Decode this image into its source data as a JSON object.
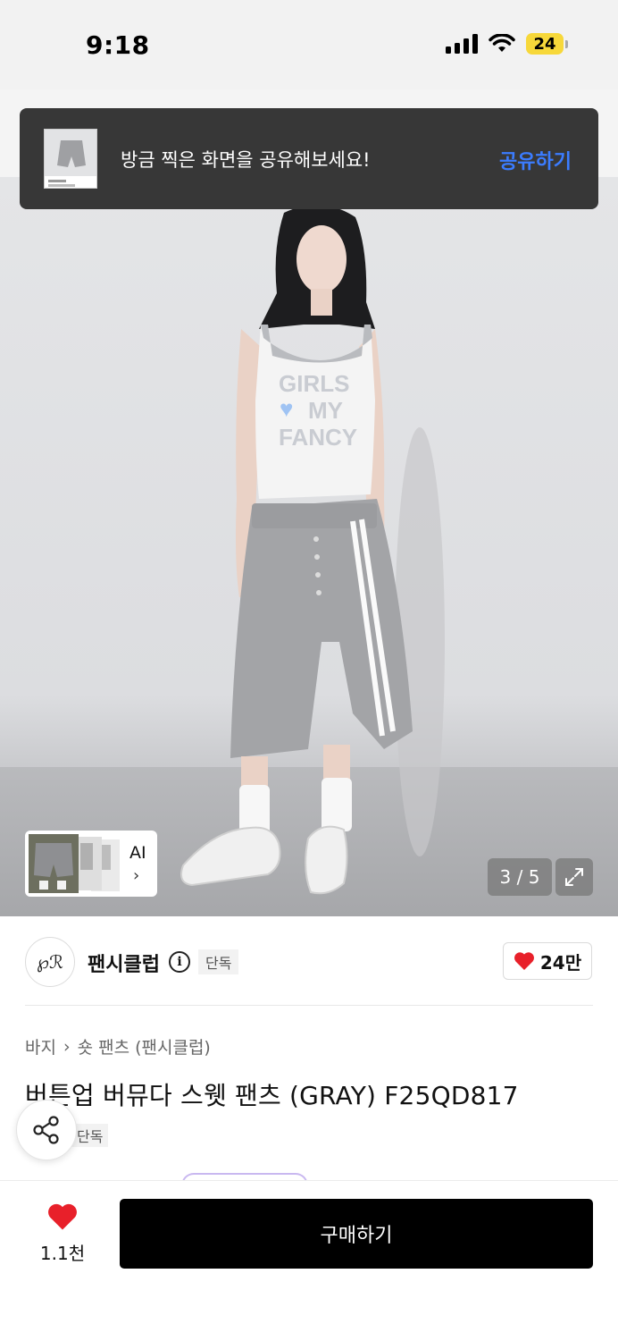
{
  "status_bar": {
    "time": "9:18",
    "battery": "24"
  },
  "toast": {
    "message": "방금 찍은 화면을 공유해보세요!",
    "action": "공유하기"
  },
  "gallery": {
    "ai_label": "AI",
    "ai_chevron": "›",
    "counter": "3 / 5"
  },
  "brand": {
    "name": "팬시클럽",
    "logo_text": "℘ℛ",
    "exclusive": "단독",
    "likes": "24만"
  },
  "breadcrumb": {
    "category": "바지",
    "separator": "›",
    "subcategory": "숏 팬츠 (팬시클럽)"
  },
  "product": {
    "title": "버튼업 버뮤다 스웻 팬츠 (GRAY) F25QD817",
    "exclusive": "단독"
  },
  "bottom_bar": {
    "wish_count": "1.1천",
    "buy_label": "구매하기"
  },
  "colors": {
    "accent_blue": "#3b7cff",
    "heart_red": "#e8202a",
    "battery_yellow": "#f7d83a"
  }
}
